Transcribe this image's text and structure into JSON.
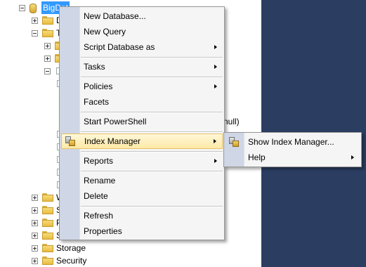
{
  "tree": {
    "database_label": "BigDat",
    "rows": [
      {
        "label": "D"
      },
      {
        "label": "T"
      },
      {
        "label": "W"
      },
      {
        "label": "S"
      },
      {
        "label": "P"
      },
      {
        "label": "S"
      },
      {
        "label": "Storage"
      },
      {
        "label": "Security"
      }
    ],
    "partial_text": "null)"
  },
  "context_menu": {
    "items": [
      {
        "label": "New Database..."
      },
      {
        "label": "New Query"
      },
      {
        "label": "Script Database as"
      },
      {
        "label": "Tasks"
      },
      {
        "label": "Policies"
      },
      {
        "label": "Facets"
      },
      {
        "label": "Start PowerShell"
      },
      {
        "label": "Index Manager"
      },
      {
        "label": "Reports"
      },
      {
        "label": "Rename"
      },
      {
        "label": "Delete"
      },
      {
        "label": "Refresh"
      },
      {
        "label": "Properties"
      }
    ]
  },
  "submenu": {
    "items": [
      {
        "label": "Show Index Manager..."
      },
      {
        "label": "Help"
      }
    ]
  },
  "colors": {
    "selection": "#3399ff",
    "highlight": "#fde9a6",
    "panel": "#2b3e62"
  }
}
